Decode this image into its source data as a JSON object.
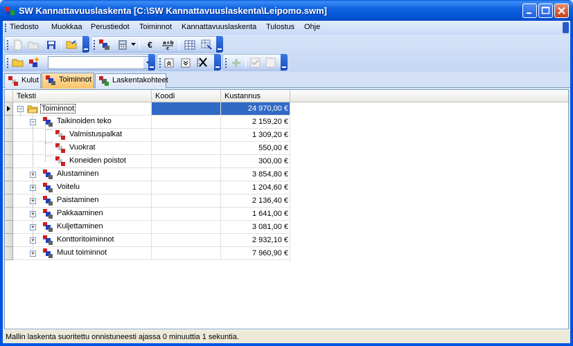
{
  "window": {
    "title": "SW Kannattavuuslaskenta [C:\\SW Kannattavuuslaskenta\\Leipomo.swm]"
  },
  "menu": [
    "Tiedosto",
    "Muokkaa",
    "Perustiedot",
    "Toiminnot",
    "Kannattavuuslaskenta",
    "Tulostus",
    "Ohje"
  ],
  "toolbar": {
    "currency_symbol": "€",
    "combo_value": ""
  },
  "tabs": [
    "Kulut",
    "Toiminnot",
    "Laskentakohteet"
  ],
  "grid": {
    "columns": [
      "Teksti",
      "Koodi",
      "Kustannus"
    ],
    "rows": [
      {
        "text": "Toiminnot",
        "code": "",
        "cost": "24 970,00 €"
      },
      {
        "text": "Taikinoiden teko",
        "code": "",
        "cost": "2 159,20 €"
      },
      {
        "text": "Valmistuspalkat",
        "code": "",
        "cost": "1 309,20 €"
      },
      {
        "text": "Vuokrat",
        "code": "",
        "cost": "550,00 €"
      },
      {
        "text": "Koneiden poistot",
        "code": "",
        "cost": "300,00 €"
      },
      {
        "text": "Alustaminen",
        "code": "",
        "cost": "3 854,80 €"
      },
      {
        "text": "Voitelu",
        "code": "",
        "cost": "1 204,60 €"
      },
      {
        "text": "Paistaminen",
        "code": "",
        "cost": "2 136,40 €"
      },
      {
        "text": "Pakkaaminen",
        "code": "",
        "cost": "1 641,00 €"
      },
      {
        "text": "Kuljettaminen",
        "code": "",
        "cost": "3 081,00 €"
      },
      {
        "text": "Konttoritoiminnot",
        "code": "",
        "cost": "2 932,10 €"
      },
      {
        "text": "Muut toiminnot",
        "code": "",
        "cost": "7 960,90 €"
      }
    ]
  },
  "status": {
    "text": "Mallin laskenta suoritettu onnistuneesti ajassa 0 minuuttia 1 sekuntia."
  }
}
